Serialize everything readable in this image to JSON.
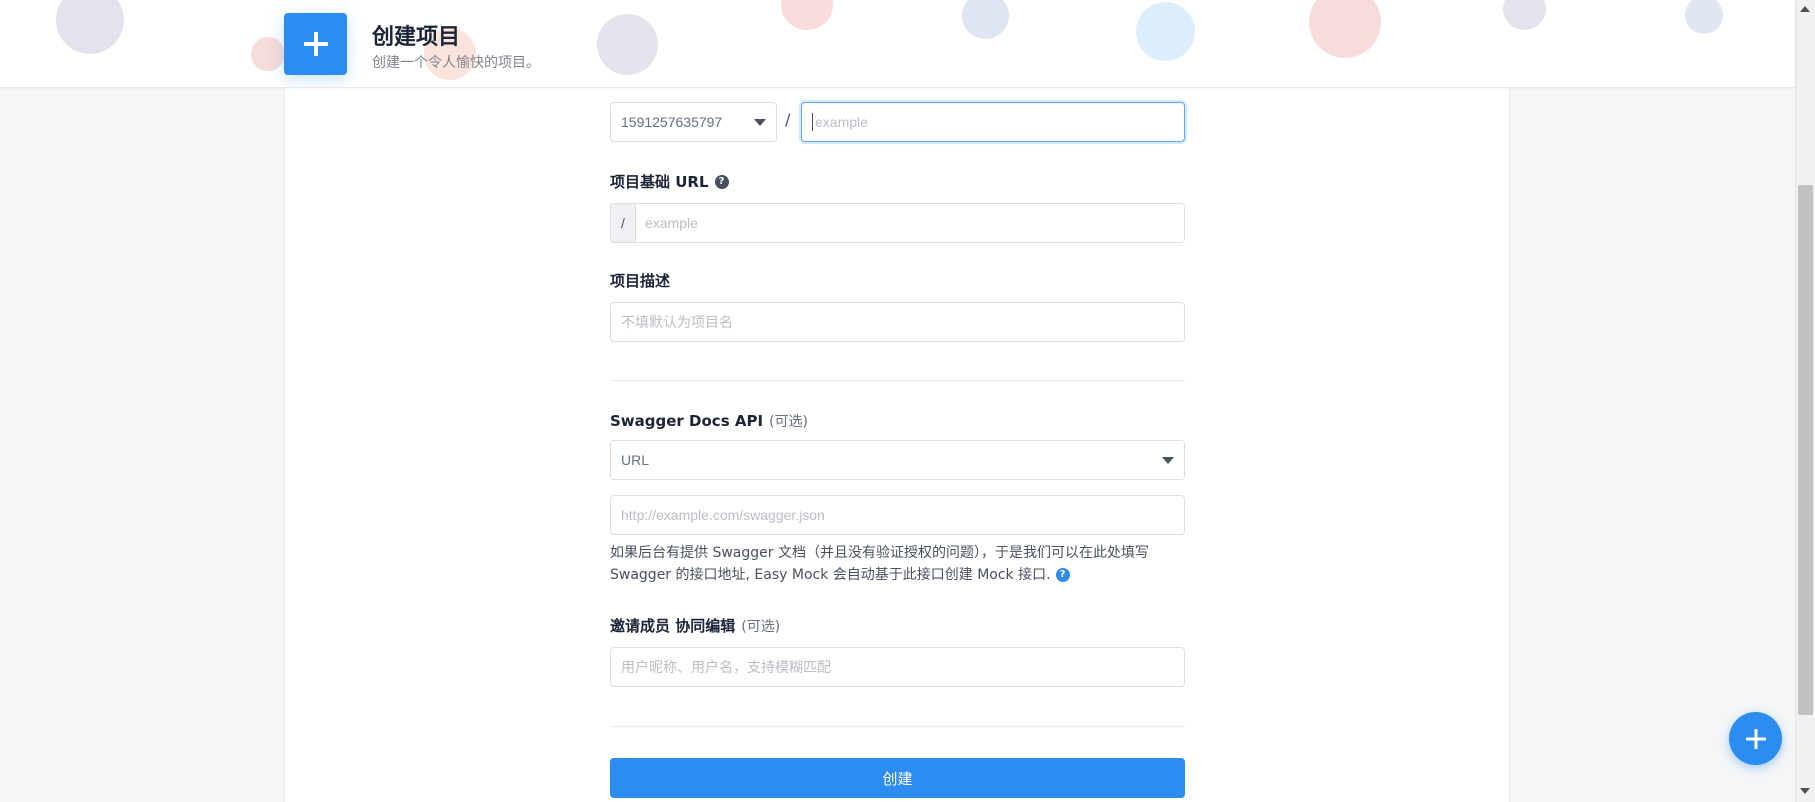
{
  "header": {
    "title": "创建项目",
    "subtitle": "创建一个令人愉快的项目。"
  },
  "form": {
    "namespace": {
      "selected": "1591257635797",
      "separator": "/",
      "name_placeholder": "example"
    },
    "base_url": {
      "label": "项目基础 URL",
      "prefix": "/",
      "placeholder": "example"
    },
    "description": {
      "label": "项目描述",
      "placeholder": "不填默认为项目名"
    },
    "swagger": {
      "label": "Swagger Docs API",
      "optional": "(可选)",
      "type_selected": "URL",
      "url_placeholder": "http://example.com/swagger.json",
      "help_line1": "如果后台有提供 Swagger 文档（并且没有验证授权的问题），于是我们可以在此处填写",
      "help_line2": "Swagger 的接口地址, Easy Mock 会自动基于此接口创建 Mock 接口."
    },
    "members": {
      "label": "邀请成员 协同编辑",
      "optional": "(可选)",
      "placeholder": "用户昵称、用户名，支持模糊匹配"
    },
    "submit_label": "创建"
  },
  "colors": {
    "primary": "#2d8cf0",
    "title": "#1c2438",
    "text": "#495060",
    "placeholder": "#bbbec4",
    "border": "#dddee1"
  }
}
